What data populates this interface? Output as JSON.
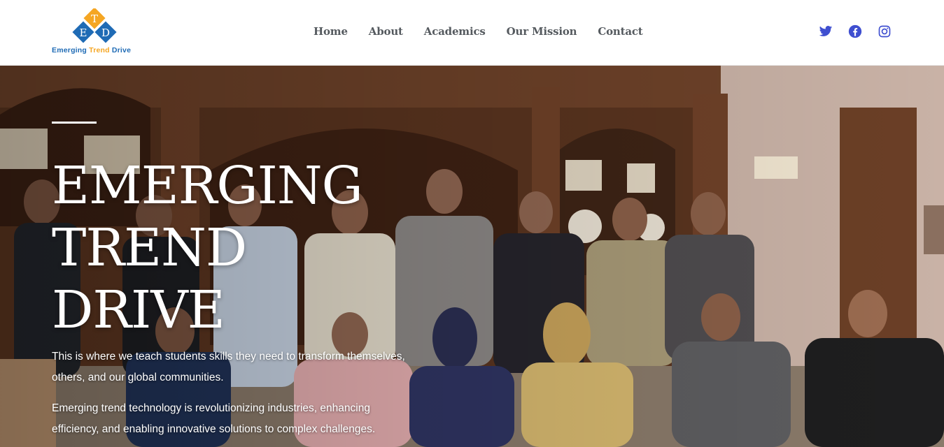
{
  "brand": {
    "logo_letters": [
      "T",
      "E",
      "D"
    ],
    "name": "Emerging Trend Drive",
    "name_parts": [
      "Emerging ",
      "Trend",
      " Drive"
    ],
    "colors": {
      "orange": "#f5a623",
      "blue": "#1f6bb5",
      "nav_text": "#555a5f",
      "social": "#3f4fd0"
    }
  },
  "nav": {
    "items": [
      {
        "label": "Home"
      },
      {
        "label": "About"
      },
      {
        "label": "Academics"
      },
      {
        "label": "Our Mission"
      },
      {
        "label": "Contact"
      }
    ]
  },
  "social": {
    "icons": [
      "twitter-icon",
      "facebook-icon",
      "instagram-icon"
    ]
  },
  "hero": {
    "title_lines": [
      "EMERGING",
      "TREND",
      "DRIVE"
    ],
    "paragraph1": "This is where we teach students skills they need to transform themselves, others, and our global communities.",
    "paragraph2": "Emerging trend technology is revolutionizing industries, enhancing efficiency, and enabling innovative solutions to complex challenges."
  }
}
